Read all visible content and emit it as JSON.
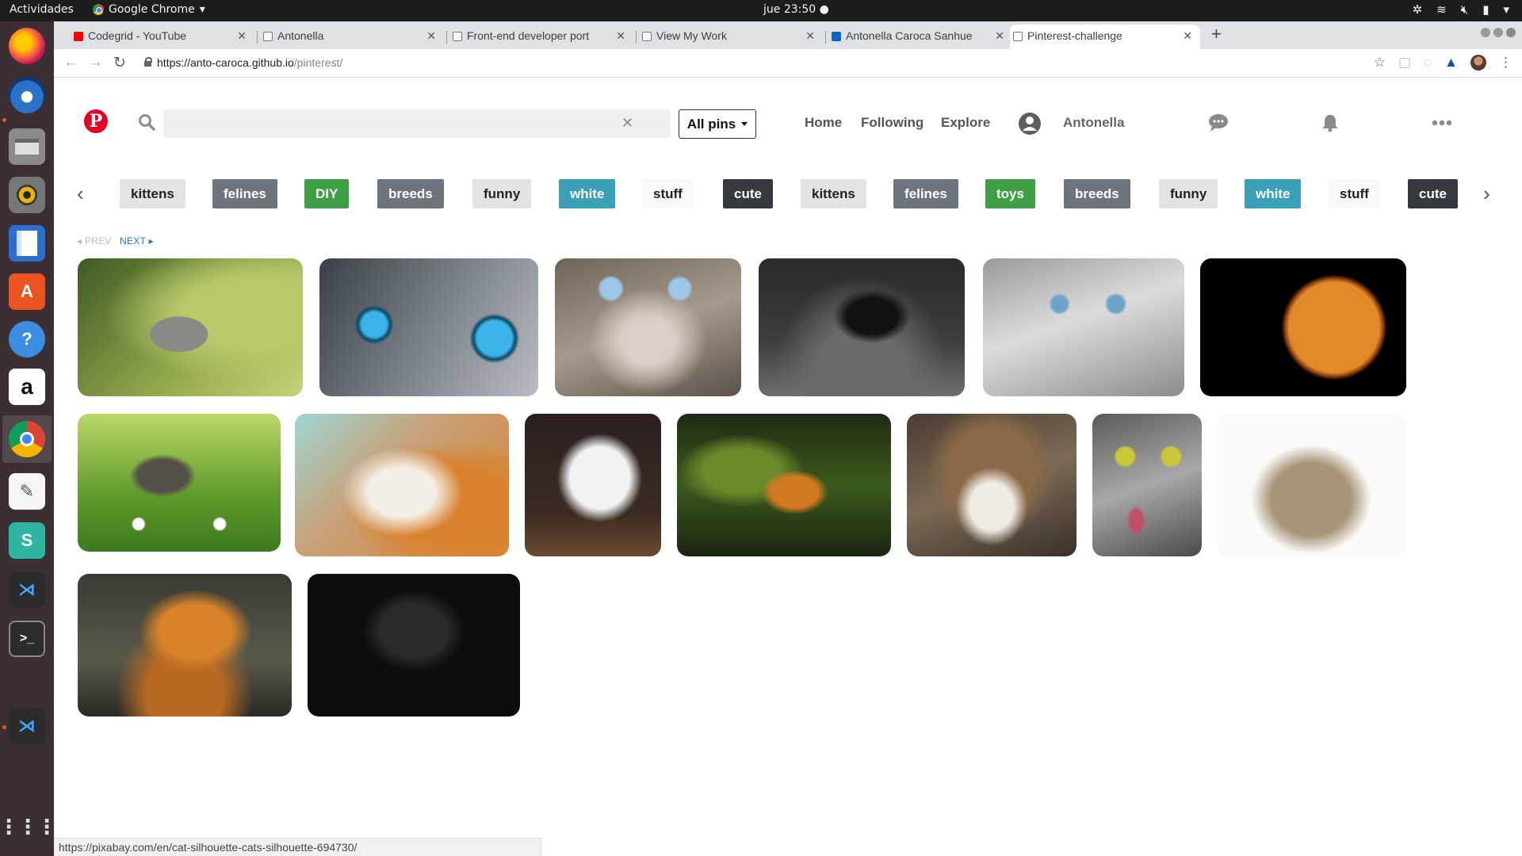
{
  "os": {
    "activities": "Actividades",
    "app_name": "Google Chrome",
    "clock": "jue 23:50 ●"
  },
  "tabs": [
    {
      "title": "Codegrid - YouTube",
      "active": false
    },
    {
      "title": "Antonella",
      "active": false
    },
    {
      "title": "Front-end developer port",
      "active": false
    },
    {
      "title": "View My Work",
      "active": false
    },
    {
      "title": "Antonella Caroca Sanhue",
      "active": false
    },
    {
      "title": "Pinterest-challenge",
      "active": true
    }
  ],
  "address": {
    "host": "https://anto-caroca.github.io",
    "path": "/pinterest/"
  },
  "header": {
    "logo_letter": "P",
    "search_placeholder": "",
    "clear": "✕",
    "filter_label": "All pins",
    "nav": [
      "Home",
      "Following",
      "Explore"
    ],
    "username": "Antonella"
  },
  "chips": [
    {
      "label": "kittens",
      "style": "light"
    },
    {
      "label": "felines",
      "style": "gray"
    },
    {
      "label": "DIY",
      "style": "green"
    },
    {
      "label": "breeds",
      "style": "gray"
    },
    {
      "label": "funny",
      "style": "light"
    },
    {
      "label": "white",
      "style": "teal"
    },
    {
      "label": "stuff",
      "style": "white"
    },
    {
      "label": "cute",
      "style": "dark"
    },
    {
      "label": "kittens",
      "style": "light"
    },
    {
      "label": "felines",
      "style": "gray"
    },
    {
      "label": "toys",
      "style": "green"
    },
    {
      "label": "breeds",
      "style": "gray"
    },
    {
      "label": "funny",
      "style": "light"
    },
    {
      "label": "white",
      "style": "teal"
    },
    {
      "label": "stuff",
      "style": "white"
    },
    {
      "label": "cute",
      "style": "dark"
    }
  ],
  "pager": {
    "prev": "◂ PREV",
    "next": "NEXT ▸"
  },
  "pins": [
    {
      "subject": "kitten-in-grass"
    },
    {
      "subject": "blue-eyed-cat-closeup"
    },
    {
      "subject": "tabby-cat-blue-eyes"
    },
    {
      "subject": "black-cat-dark"
    },
    {
      "subject": "gray-longhair-cat"
    },
    {
      "subject": "cat-silhouette-moon"
    },
    {
      "subject": "kitten-in-flowers"
    },
    {
      "subject": "orange-cat-licking"
    },
    {
      "subject": "white-kitten"
    },
    {
      "subject": "tiger-in-water"
    },
    {
      "subject": "tabby-cat-portrait"
    },
    {
      "subject": "gray-tabby-licking"
    },
    {
      "subject": "kitten-white-background"
    },
    {
      "subject": "roaring-tiger"
    },
    {
      "subject": "black-cat-yellow-eyes"
    }
  ],
  "status_url": "https://pixabay.com/en/cat-silhouette-cats-silhouette-694730/",
  "colors": {
    "pinterest_red": "#e60023",
    "link_blue": "#1a73e8",
    "dock_bg": "#3c2f33",
    "chip_green": "#3f9f44",
    "chip_teal": "#3aa0b7",
    "chip_gray": "#6c757d",
    "chip_dark": "#343a40"
  }
}
